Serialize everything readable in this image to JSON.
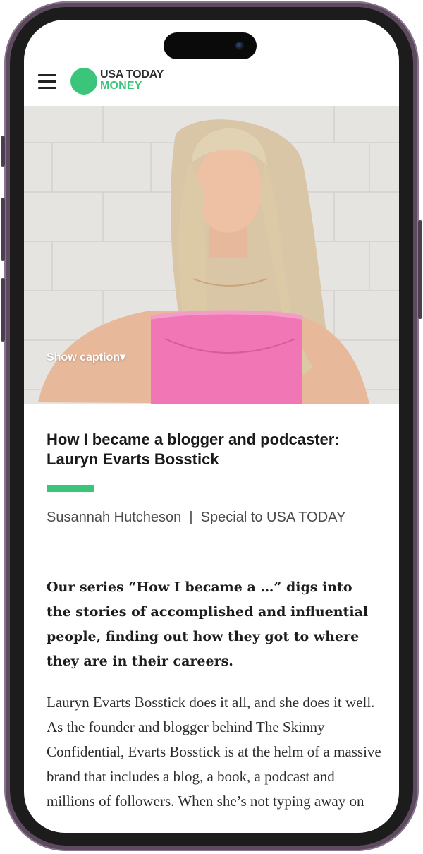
{
  "site": {
    "logo_line1": "USA TODAY",
    "logo_line2": "MONEY",
    "brand_color": "#3bc57a"
  },
  "hero": {
    "caption_toggle": "Show caption▾"
  },
  "article": {
    "headline": "How I became a blogger and podcaster: Lauryn Evarts Bosstick",
    "byline": "Susannah Hutcheson  |  Special to USA TODAY",
    "lede": "Our series “How I became a …” digs into the stories of accomplished and influential people, finding out how they got to where they are in their careers.",
    "body": "Lauryn Evarts Bosstick does it all, and she does it well. As the founder and blogger behind The Skinny Confidential, Evarts Bosstick is at the helm of a massive brand that includes a blog, a book, a podcast and millions of followers. When she’s not typing away on"
  },
  "icons": {
    "menu": "hamburger-menu-icon"
  }
}
